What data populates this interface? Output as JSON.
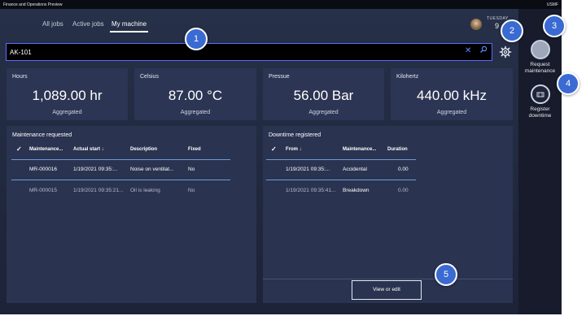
{
  "window": {
    "title": "Finance and Operations Preview",
    "company": "USMF"
  },
  "tabs": [
    {
      "label": "All jobs"
    },
    {
      "label": "Active jobs"
    },
    {
      "label": "My machine"
    }
  ],
  "user": {
    "day": "TUESDAY",
    "value": "9"
  },
  "search": {
    "value": "AK-101"
  },
  "metrics": [
    {
      "label": "Hours",
      "value": "1,089.00 hr",
      "sub": "Aggregated"
    },
    {
      "label": "Celsius",
      "value": "87.00 °C",
      "sub": "Aggregated"
    },
    {
      "label": "Pressue",
      "value": "56.00 Bar",
      "sub": "Aggregated"
    },
    {
      "label": "Kilohertz",
      "value": "440.00 kHz",
      "sub": "Aggregated"
    }
  ],
  "maintenance": {
    "title": "Maintenance requested",
    "columns": [
      "Maintenance...",
      "Actual start ↓",
      "Description",
      "Fixed"
    ],
    "rows": [
      [
        "MR-000016",
        "1/19/2021 09:35:...",
        "Noise on ventilat...",
        "No"
      ],
      [
        "MR-000015",
        "1/19/2021 09:35:21...",
        "Oil is leaking",
        "No"
      ]
    ]
  },
  "downtime": {
    "title": "Downtime registered",
    "columns": [
      "From ↓",
      "Maintenance...",
      "Duration"
    ],
    "rows": [
      [
        "1/19/2021 09:35:...",
        "Accidental",
        "0.00"
      ],
      [
        "1/19/2021 09:35:41...",
        "Breakdown",
        "0.00"
      ]
    ],
    "button": "View or edit"
  },
  "actions": {
    "request_label": "Request maintenance",
    "register_label": "Register downtime"
  },
  "callouts": [
    "1",
    "2",
    "3",
    "4",
    "5"
  ],
  "colors": {
    "accent": "#5b6cff",
    "callout": "#3a6ad2",
    "background": "#1f2438"
  }
}
